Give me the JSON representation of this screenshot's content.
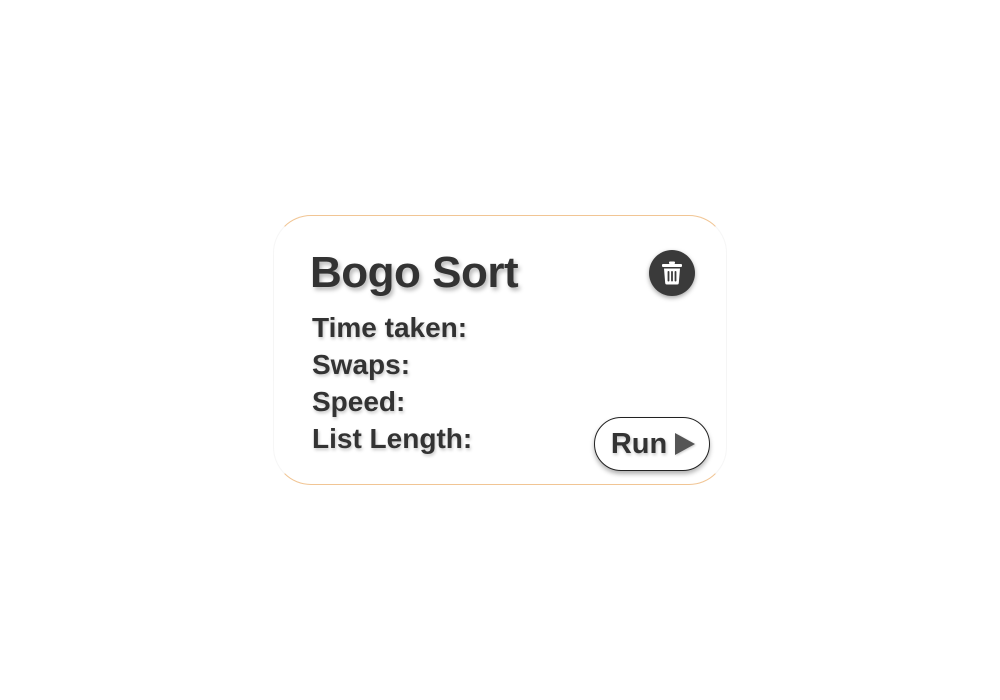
{
  "card": {
    "title": "Bogo Sort",
    "stats": [
      {
        "label": "Time taken:"
      },
      {
        "label": "Swaps:"
      },
      {
        "label": "Speed:"
      },
      {
        "label": "List Length:"
      }
    ],
    "delete_icon": "trash-icon",
    "run_label": "Run",
    "run_icon": "play-icon"
  },
  "colors": {
    "text": "#333333",
    "delete_button_bg": "#3a3a3a",
    "card_border_accent": "#e6963c"
  }
}
